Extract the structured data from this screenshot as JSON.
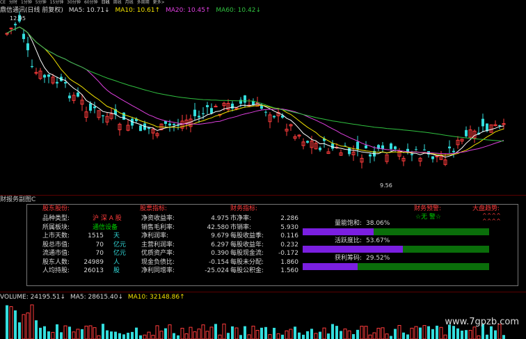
{
  "period_bar": [
    "CE",
    "分时",
    "1分钟",
    "5分钟",
    "15分钟",
    "30分钟",
    "60分钟",
    "日线",
    "周线",
    "月线",
    "多周期",
    "更多>"
  ],
  "period_selected": "日线",
  "price_header": {
    "title": "鼎信通讯(日线 前复权)",
    "ma5": "MA5: 10.71↓",
    "ma10": "MA10: 10.61↑",
    "ma20": "MA20: 10.45↑",
    "ma60": "MA60: 10.42↓"
  },
  "chart_labels": {
    "high": "12.95",
    "low": "9.56"
  },
  "subpanel_title": "财报务副图C",
  "fin": {
    "sections": {
      "holders": "股东股份:",
      "indicators": "股票指标:",
      "finance": "财务指标:",
      "warning": "财务预警:",
      "trend": "大盘趋势:"
    },
    "col1": [
      {
        "label": "品种类型:",
        "value": "沪 深 A 股",
        "unit": ""
      },
      {
        "label": "所属板块:",
        "value": "通信设备",
        "unit": ""
      },
      {
        "label": "上市天数:",
        "value": "1515",
        "unit": "天"
      },
      {
        "label": "股总市值:",
        "value": "70",
        "unit": "亿元"
      },
      {
        "label": "流通市值:",
        "value": "70",
        "unit": "亿元"
      },
      {
        "label": "股东人数:",
        "value": "24989",
        "unit": "人"
      },
      {
        "label": "人均持股:",
        "value": "26013",
        "unit": "股"
      }
    ],
    "col2": [
      {
        "label": "净资收益率:",
        "value": "4.975"
      },
      {
        "label": "销售毛利率:",
        "value": "42.580"
      },
      {
        "label": "净利润率:",
        "value": "9.679"
      },
      {
        "label": "主营利润率:",
        "value": "6.297"
      },
      {
        "label": "优质资产率:",
        "value": "0.390"
      },
      {
        "label": "现金负债比:",
        "value": "-0.154"
      },
      {
        "label": "净利同增率:",
        "value": "-25.024"
      }
    ],
    "col3": [
      {
        "label": "市净率:",
        "value": "2.286"
      },
      {
        "label": "市销率:",
        "value": "5.930"
      },
      {
        "label": "每股收益季:",
        "value": "0.116"
      },
      {
        "label": "每股收益年:",
        "value": "0.232"
      },
      {
        "label": "每股现金流:",
        "value": "-0.172"
      },
      {
        "label": "每股未分配:",
        "value": "1.860"
      },
      {
        "label": "每股公积金:",
        "value": "1.560"
      }
    ],
    "bars": [
      {
        "label": "量能饱和:",
        "value": "38.06%",
        "fraction": 0.3806
      },
      {
        "label": "活跃度比:",
        "value": "53.67%",
        "fraction": 0.5367
      },
      {
        "label": "获利筹码:",
        "value": "29.52%",
        "fraction": 0.2952
      }
    ],
    "warning_value": "☆无 警☆",
    "trend_value": "^^^^"
  },
  "volume_header": {
    "vol": "VOLUME: 24195.51↓",
    "ma5": "MA5: 28615.40↓",
    "ma10": "MA10: 32148.86↑"
  },
  "watermark": "www.7gpzb.com",
  "colors": {
    "up": "#ff3c3c",
    "down": "#33dddd",
    "ma5": "#ffffff",
    "ma10": "#f0e000",
    "ma20": "#e040e0",
    "ma60": "#30c040"
  }
}
